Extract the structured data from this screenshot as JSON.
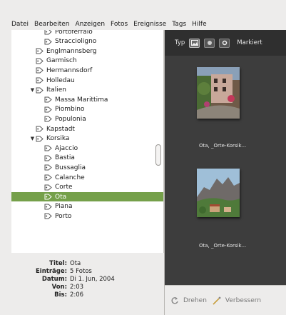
{
  "menubar": {
    "items": [
      "Datei",
      "Bearbeiten",
      "Anzeigen",
      "Fotos",
      "Ereignisse",
      "Tags",
      "Hilfe"
    ]
  },
  "tree": {
    "items": [
      {
        "label": "Portoferraio",
        "level": 2,
        "expander": ""
      },
      {
        "label": "Straccioligno",
        "level": 2,
        "expander": ""
      },
      {
        "label": "Englmannsberg",
        "level": 1,
        "expander": ""
      },
      {
        "label": "Garmisch",
        "level": 1,
        "expander": ""
      },
      {
        "label": "Hermannsdorf",
        "level": 1,
        "expander": ""
      },
      {
        "label": "Holledau",
        "level": 1,
        "expander": ""
      },
      {
        "label": "Italien",
        "level": 1,
        "expander": "▼"
      },
      {
        "label": "Massa Marittima",
        "level": 2,
        "expander": ""
      },
      {
        "label": "Piombino",
        "level": 2,
        "expander": ""
      },
      {
        "label": "Populonia",
        "level": 2,
        "expander": ""
      },
      {
        "label": "Kapstadt",
        "level": 1,
        "expander": ""
      },
      {
        "label": "Korsika",
        "level": 1,
        "expander": "▼"
      },
      {
        "label": "Ajaccio",
        "level": 2,
        "expander": ""
      },
      {
        "label": "Bastia",
        "level": 2,
        "expander": ""
      },
      {
        "label": "Bussaglia",
        "level": 2,
        "expander": ""
      },
      {
        "label": "Calanche",
        "level": 2,
        "expander": ""
      },
      {
        "label": "Corte",
        "level": 2,
        "expander": ""
      },
      {
        "label": "Ota",
        "level": 2,
        "expander": "",
        "selected": true
      },
      {
        "label": "Piana",
        "level": 2,
        "expander": ""
      },
      {
        "label": "Porto",
        "level": 2,
        "expander": ""
      }
    ]
  },
  "info": {
    "rows": [
      {
        "key": "Titel:",
        "value": "Ota"
      },
      {
        "key": "Einträge:",
        "value": "5 Fotos"
      },
      {
        "key": "Datum:",
        "value": "Di 1. Jun, 2004"
      },
      {
        "key": "Von:",
        "value": "2:03"
      },
      {
        "key": "Bis:",
        "value": "2:06"
      }
    ]
  },
  "viewer": {
    "toolbar": {
      "type_label": "Typ",
      "marker_label": "Markiert"
    },
    "thumbnails": [
      {
        "caption": "Ota, _Orte-Korsik..."
      },
      {
        "caption": "Ota, _Orte-Korsik..."
      }
    ]
  },
  "bottom_bar": {
    "rotate_label": "Drehen",
    "enhance_label": "Verbessern"
  },
  "colors": {
    "selection": "#75a04a",
    "viewer_bg": "#3d3d3d",
    "toolbar_bg": "#2f2f2f"
  }
}
